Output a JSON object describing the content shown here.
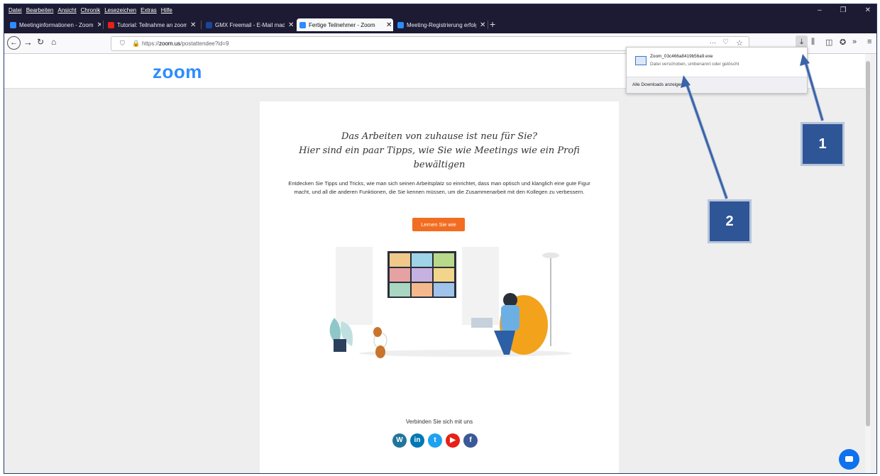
{
  "menubar": {
    "items": [
      "Datei",
      "Bearbeiten",
      "Ansicht",
      "Chronik",
      "Lesezeichen",
      "Extras",
      "Hilfe"
    ]
  },
  "window_controls": [
    "–",
    "❐",
    "✕"
  ],
  "tabs": [
    {
      "label": "Meetinginformationen - Zoom",
      "color": "#2d8cff",
      "active": false
    },
    {
      "label": "Tutorial: Teilnahme an zoom M",
      "color": "#e62117",
      "active": false
    },
    {
      "label": "GMX Freemail - E-Mail made in",
      "color": "#1c449b",
      "active": false
    },
    {
      "label": "Fertige Teilnehmer - Zoom",
      "color": "#2d8cff",
      "active": true
    },
    {
      "label": "Meeting-Registrierung erfolgre",
      "color": "#2d8cff",
      "active": false
    }
  ],
  "nav": {
    "url_prefix": "https://",
    "url_domain": "zoom.us",
    "url_path": "/postattendee?id=9",
    "page_actions": "···"
  },
  "icons": {
    "back": "arrow-left-icon",
    "forward": "arrow-right-icon",
    "reload": "reload-icon",
    "home": "home-icon",
    "download": "download-icon",
    "library": "library-icon",
    "sidebar": "sidebar-icon",
    "extension": "extension-icon",
    "overflow": "overflow-icon",
    "menu": "hamburger-menu-icon"
  },
  "downloads_panel": {
    "file_name": "Zoom_03c466a8419b56a9.exe",
    "file_status": "Datei verschoben, umbenannt oder gelöscht",
    "show_all": "Alle Downloads anzeigen"
  },
  "page": {
    "logo": "zoom",
    "headline_1": "Das Arbeiten von zuhause ist neu für Sie?",
    "headline_2": "Hier sind ein paar Tipps, wie Sie wie Meetings wie ein Profi",
    "headline_3": "bewältigen",
    "body_text": "Entdecken Sie Tipps und Tricks, wie man sich seinen Arbeitsplatz so einrichtet, dass man optisch und klanglich eine gute Figur macht, und all die anderen Funktionen, die Sie kennen müssen, um die Zusammenarbeit mit den Kollegen zu verbessern.",
    "cta_label": "Lernen Sie wie",
    "connect_label": "Verbinden Sie sich mit uns",
    "social": [
      {
        "name": "wordpress",
        "glyph": "W",
        "color": "#21759b"
      },
      {
        "name": "linkedin",
        "glyph": "in",
        "color": "#0077b5"
      },
      {
        "name": "twitter",
        "glyph": "t",
        "color": "#1da1f2"
      },
      {
        "name": "youtube",
        "glyph": "▶",
        "color": "#e62117"
      },
      {
        "name": "facebook",
        "glyph": "f",
        "color": "#3b5998"
      }
    ]
  },
  "callouts": {
    "one": "1",
    "two": "2"
  },
  "colors": {
    "accent": "#2d8cff",
    "cta": "#f26d21",
    "callout": "#2e5596",
    "titlebar": "#1c1b33"
  }
}
